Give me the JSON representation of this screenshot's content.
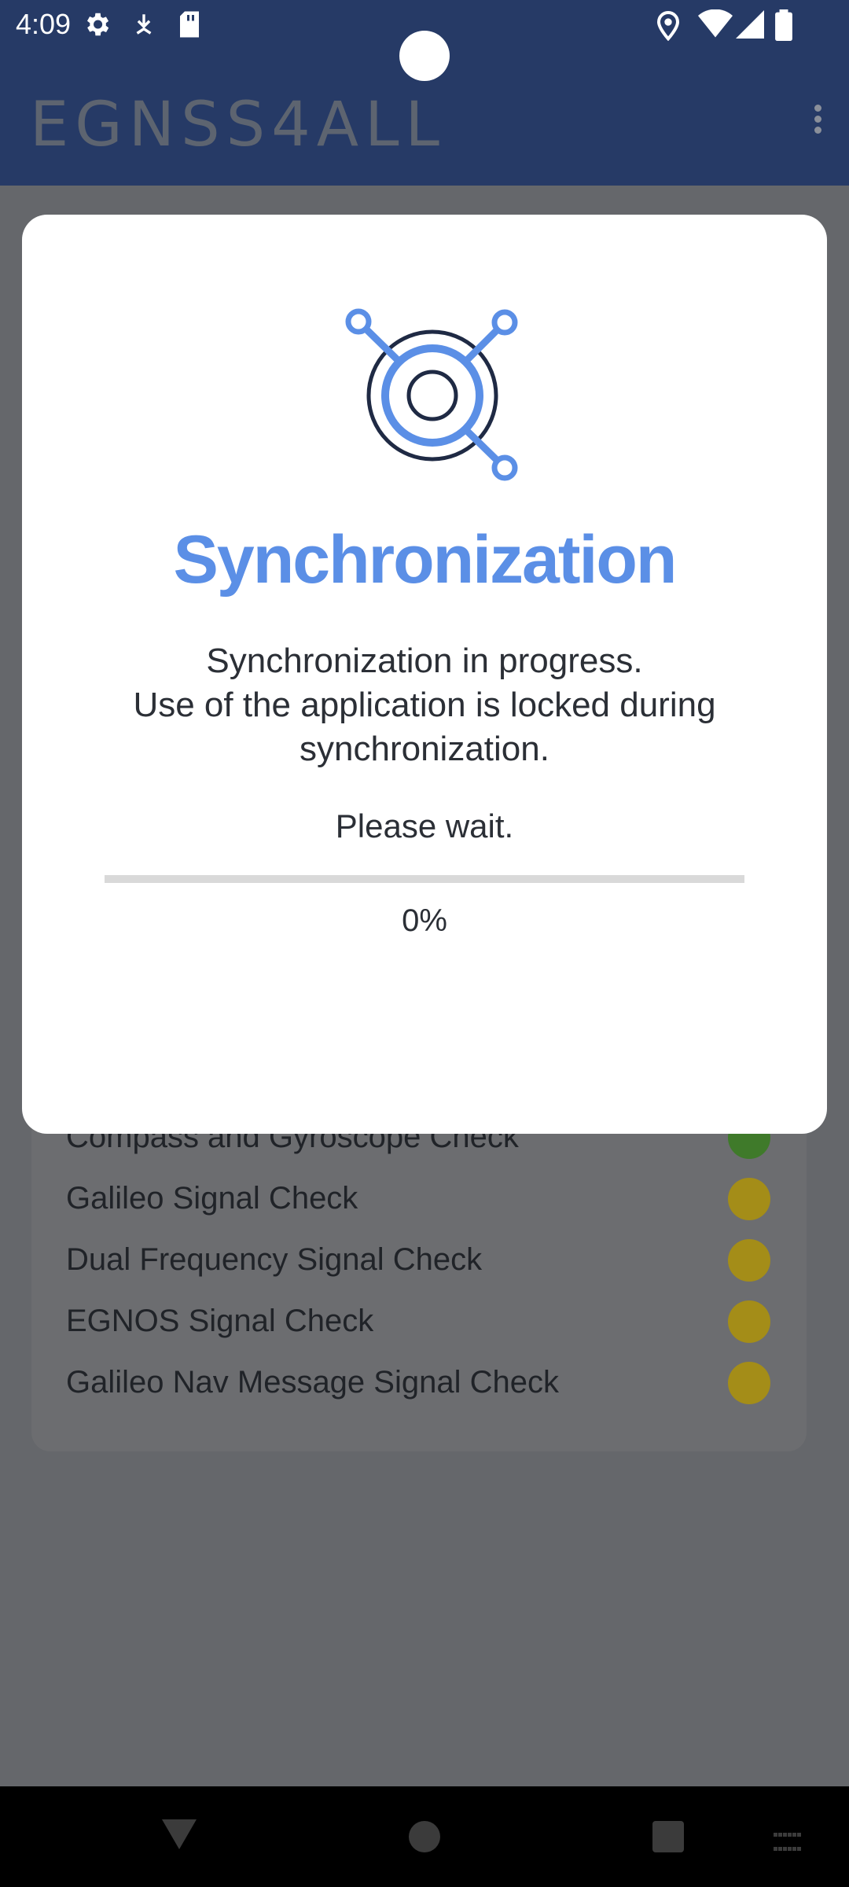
{
  "status_bar": {
    "time": "4:09",
    "left_icons": [
      "gear-icon",
      "download-icon",
      "sd-card-icon"
    ],
    "right_icons": [
      "location-icon",
      "wifi-icon",
      "signal-icon",
      "battery-icon"
    ]
  },
  "app_bar": {
    "title": "EGNSS4ALL",
    "menu_icon": "more-vert-icon"
  },
  "checks": [
    {
      "label": "Compass and Gyroscope Check",
      "status_color": "#3f7a2a"
    },
    {
      "label": "Galileo Signal Check",
      "status_color": "#a48d18"
    },
    {
      "label": "Dual Frequency Signal Check",
      "status_color": "#a48d18"
    },
    {
      "label": "EGNOS Signal Check",
      "status_color": "#a48d18"
    },
    {
      "label": "Galileo Nav Message Signal Check",
      "status_color": "#a48d18"
    }
  ],
  "dialog": {
    "icon": "sync-network-icon",
    "title": "Synchronization",
    "message_lines": [
      "Synchronization in progress.",
      "Use of the application is locked during",
      "synchronization."
    ],
    "wait_text": "Please wait.",
    "progress": 0,
    "progress_text": "0%"
  },
  "colors": {
    "primary": "#263a66",
    "accent": "#5b8fe6",
    "scrim": "#65676b"
  },
  "nav_bar": {
    "buttons": [
      "back-icon",
      "home-icon",
      "recents-icon",
      "keyboard-icon"
    ]
  }
}
